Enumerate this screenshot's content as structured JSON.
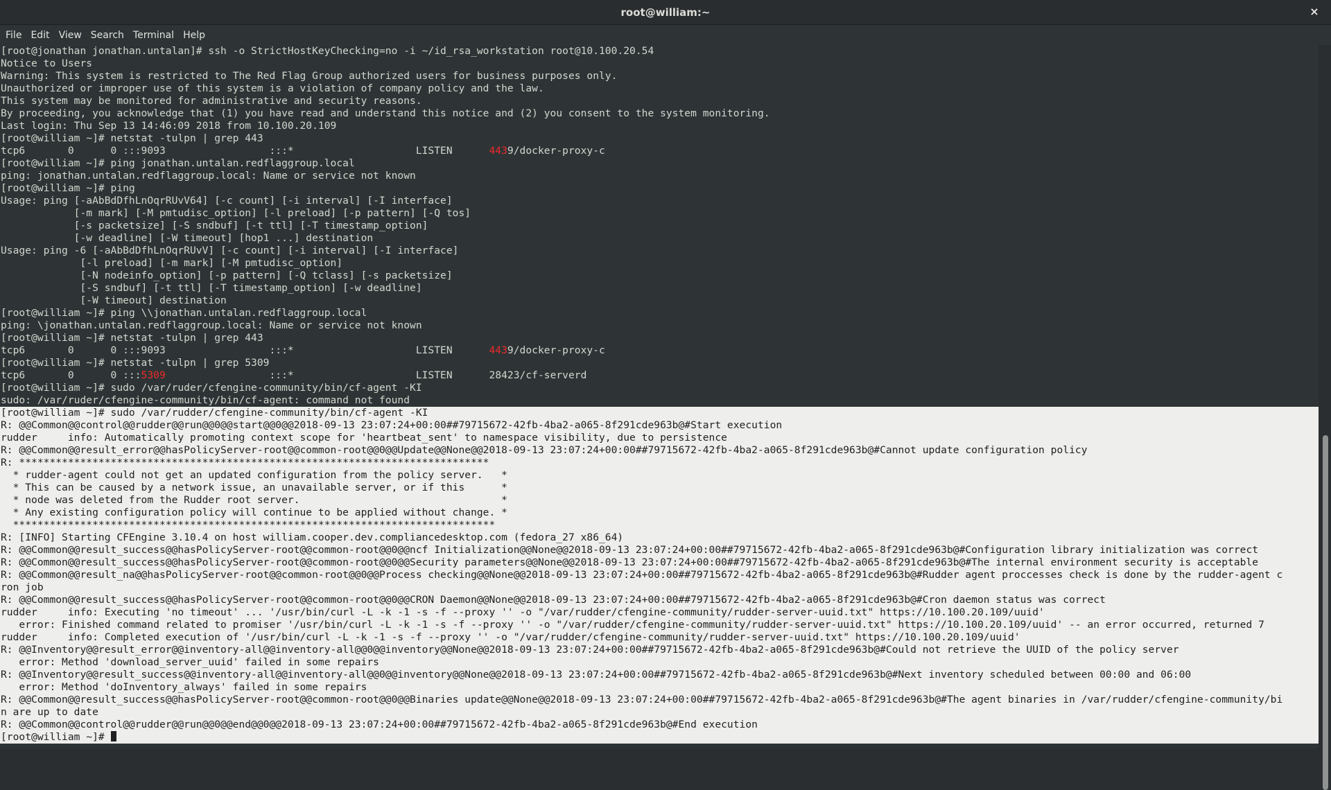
{
  "window": {
    "title": "root@william:~",
    "close_label": "×"
  },
  "menu": {
    "file": "File",
    "edit": "Edit",
    "view": "View",
    "search": "Search",
    "terminal": "Terminal",
    "help": "Help"
  },
  "terminal": {
    "dark_lines": [
      [
        "[root@jonathan jonathan.untalan]# ssh -o StrictHostKeyChecking=no -i ~/id_rsa_workstation root@10.100.20.54"
      ],
      [
        "Notice to Users"
      ],
      [
        "Warning: This system is restricted to The Red Flag Group authorized users for business purposes only."
      ],
      [
        "Unauthorized or improper use of this system is a violation of company policy and the law."
      ],
      [
        "This system may be monitored for administrative and security reasons."
      ],
      [
        "By proceeding, you acknowledge that (1) you have read and understand this notice and (2) you consent to the system monitoring."
      ],
      [
        "Last login: Thu Sep 13 14:46:09 2018 from 10.100.20.109"
      ],
      [
        "[root@william ~]# netstat -tulpn | grep 443"
      ],
      [
        "tcp6       0      0 :::9093                 :::*                    LISTEN      ",
        "443",
        "9/docker-proxy-c"
      ],
      [
        "[root@william ~]# ping jonathan.untalan.redflaggroup.local"
      ],
      [
        "ping: jonathan.untalan.redflaggroup.local: Name or service not known"
      ],
      [
        "[root@william ~]# ping"
      ],
      [
        "Usage: ping [-aAbBdDfhLnOqrRUvV64] [-c count] [-i interval] [-I interface]"
      ],
      [
        "            [-m mark] [-M pmtudisc_option] [-l preload] [-p pattern] [-Q tos]"
      ],
      [
        "            [-s packetsize] [-S sndbuf] [-t ttl] [-T timestamp_option]"
      ],
      [
        "            [-w deadline] [-W timeout] [hop1 ...] destination"
      ],
      [
        "Usage: ping -6 [-aAbBdDfhLnOqrRUvV] [-c count] [-i interval] [-I interface]"
      ],
      [
        "             [-l preload] [-m mark] [-M pmtudisc_option]"
      ],
      [
        "             [-N nodeinfo_option] [-p pattern] [-Q tclass] [-s packetsize]"
      ],
      [
        "             [-S sndbuf] [-t ttl] [-T timestamp_option] [-w deadline]"
      ],
      [
        "             [-W timeout] destination"
      ],
      [
        "[root@william ~]# ping \\\\jonathan.untalan.redflaggroup.local"
      ],
      [
        "ping: \\jonathan.untalan.redflaggroup.local: Name or service not known"
      ],
      [
        "[root@william ~]# netstat -tulpn | grep 443"
      ],
      [
        "tcp6       0      0 :::9093                 :::*                    LISTEN      ",
        "443",
        "9/docker-proxy-c"
      ],
      [
        "[root@william ~]# netstat -tulpn | grep 5309"
      ],
      [
        "tcp6       0      0 :::",
        "5309",
        "                 :::*                    LISTEN      28423/cf-serverd"
      ],
      [
        "[root@william ~]# sudo /var/ruder/cfengine-community/bin/cf-agent -KI"
      ],
      [
        "sudo: /var/ruder/cfengine-community/bin/cf-agent: command not found"
      ]
    ],
    "light_lines": [
      "[root@william ~]# sudo /var/rudder/cfengine-community/bin/cf-agent -KI",
      "R: @@Common@@control@@rudder@@run@@0@@start@@0@@2018-09-13 23:07:24+00:00##79715672-42fb-4ba2-a065-8f291cde963b@#Start execution",
      "rudder     info: Automatically promoting context scope for 'heartbeat_sent' to namespace visibility, due to persistence",
      "R: @@Common@@result_error@@hasPolicyServer-root@@common-root@@0@@Update@@None@@2018-09-13 23:07:24+00:00##79715672-42fb-4ba2-a065-8f291cde963b@#Cannot update configuration policy",
      "R: *****************************************************************************",
      "  * rudder-agent could not get an updated configuration from the policy server.   *",
      "  * This can be caused by a network issue, an unavailable server, or if this      *",
      "  * node was deleted from the Rudder root server.                                 *",
      "  * Any existing configuration policy will continue to be applied without change. *",
      "  *******************************************************************************",
      "R: [INFO] Starting CFEngine 3.10.4 on host william.cooper.dev.compliancedesktop.com (fedora_27 x86_64)",
      "R: @@Common@@result_success@@hasPolicyServer-root@@common-root@@0@@ncf Initialization@@None@@2018-09-13 23:07:24+00:00##79715672-42fb-4ba2-a065-8f291cde963b@#Configuration library initialization was correct",
      "R: @@Common@@result_success@@hasPolicyServer-root@@common-root@@0@@Security parameters@@None@@2018-09-13 23:07:24+00:00##79715672-42fb-4ba2-a065-8f291cde963b@#The internal environment security is acceptable",
      "R: @@Common@@result_na@@hasPolicyServer-root@@common-root@@0@@Process checking@@None@@2018-09-13 23:07:24+00:00##79715672-42fb-4ba2-a065-8f291cde963b@#Rudder agent proccesses check is done by the rudder-agent c",
      "ron job",
      "R: @@Common@@result_success@@hasPolicyServer-root@@common-root@@0@@CRON Daemon@@None@@2018-09-13 23:07:24+00:00##79715672-42fb-4ba2-a065-8f291cde963b@#Cron daemon status was correct",
      "rudder     info: Executing 'no timeout' ... '/usr/bin/curl -L -k -1 -s -f --proxy '' -o \"/var/rudder/cfengine-community/rudder-server-uuid.txt\" https://10.100.20.109/uuid'",
      "   error: Finished command related to promiser '/usr/bin/curl -L -k -1 -s -f --proxy '' -o \"/var/rudder/cfengine-community/rudder-server-uuid.txt\" https://10.100.20.109/uuid' -- an error occurred, returned 7",
      "rudder     info: Completed execution of '/usr/bin/curl -L -k -1 -s -f --proxy '' -o \"/var/rudder/cfengine-community/rudder-server-uuid.txt\" https://10.100.20.109/uuid'",
      "R: @@Inventory@@result_error@@inventory-all@@inventory-all@@0@@inventory@@None@@2018-09-13 23:07:24+00:00##79715672-42fb-4ba2-a065-8f291cde963b@#Could not retrieve the UUID of the policy server",
      "   error: Method 'download_server_uuid' failed in some repairs",
      "R: @@Inventory@@result_success@@inventory-all@@inventory-all@@0@@inventory@@None@@2018-09-13 23:07:24+00:00##79715672-42fb-4ba2-a065-8f291cde963b@#Next inventory scheduled between 00:00 and 06:00",
      "   error: Method 'doInventory_always' failed in some repairs",
      "R: @@Common@@result_success@@hasPolicyServer-root@@common-root@@0@@Binaries update@@None@@2018-09-13 23:07:24+00:00##79715672-42fb-4ba2-a065-8f291cde963b@#The agent binaries in /var/rudder/cfengine-community/bi",
      "n are up to date",
      "R: @@Common@@control@@rudder@@run@@0@@end@@0@@2018-09-13 23:07:24+00:00##79715672-42fb-4ba2-a065-8f291cde963b@#End execution",
      "[root@william ~]# "
    ],
    "colors": {
      "dark_bg": "#2e3436",
      "dark_fg": "#d3d7cf",
      "light_bg": "#eeeeec",
      "light_fg": "#1e2021",
      "highlight": "#ef2929"
    }
  }
}
